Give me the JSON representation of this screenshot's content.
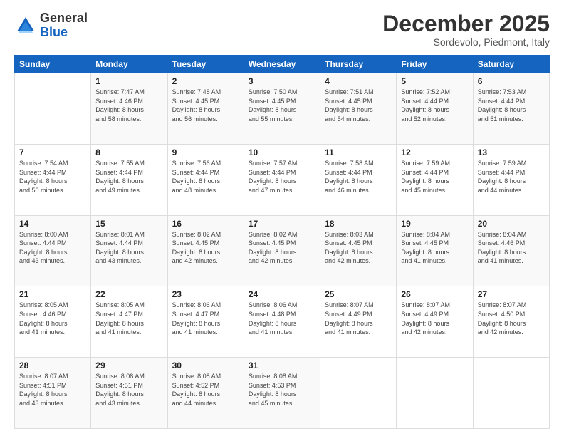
{
  "logo": {
    "general": "General",
    "blue": "Blue"
  },
  "title": "December 2025",
  "subtitle": "Sordevolo, Piedmont, Italy",
  "days_of_week": [
    "Sunday",
    "Monday",
    "Tuesday",
    "Wednesday",
    "Thursday",
    "Friday",
    "Saturday"
  ],
  "weeks": [
    [
      {
        "num": "",
        "detail": ""
      },
      {
        "num": "1",
        "detail": "Sunrise: 7:47 AM\nSunset: 4:46 PM\nDaylight: 8 hours\nand 58 minutes."
      },
      {
        "num": "2",
        "detail": "Sunrise: 7:48 AM\nSunset: 4:45 PM\nDaylight: 8 hours\nand 56 minutes."
      },
      {
        "num": "3",
        "detail": "Sunrise: 7:50 AM\nSunset: 4:45 PM\nDaylight: 8 hours\nand 55 minutes."
      },
      {
        "num": "4",
        "detail": "Sunrise: 7:51 AM\nSunset: 4:45 PM\nDaylight: 8 hours\nand 54 minutes."
      },
      {
        "num": "5",
        "detail": "Sunrise: 7:52 AM\nSunset: 4:44 PM\nDaylight: 8 hours\nand 52 minutes."
      },
      {
        "num": "6",
        "detail": "Sunrise: 7:53 AM\nSunset: 4:44 PM\nDaylight: 8 hours\nand 51 minutes."
      }
    ],
    [
      {
        "num": "7",
        "detail": "Sunrise: 7:54 AM\nSunset: 4:44 PM\nDaylight: 8 hours\nand 50 minutes."
      },
      {
        "num": "8",
        "detail": "Sunrise: 7:55 AM\nSunset: 4:44 PM\nDaylight: 8 hours\nand 49 minutes."
      },
      {
        "num": "9",
        "detail": "Sunrise: 7:56 AM\nSunset: 4:44 PM\nDaylight: 8 hours\nand 48 minutes."
      },
      {
        "num": "10",
        "detail": "Sunrise: 7:57 AM\nSunset: 4:44 PM\nDaylight: 8 hours\nand 47 minutes."
      },
      {
        "num": "11",
        "detail": "Sunrise: 7:58 AM\nSunset: 4:44 PM\nDaylight: 8 hours\nand 46 minutes."
      },
      {
        "num": "12",
        "detail": "Sunrise: 7:59 AM\nSunset: 4:44 PM\nDaylight: 8 hours\nand 45 minutes."
      },
      {
        "num": "13",
        "detail": "Sunrise: 7:59 AM\nSunset: 4:44 PM\nDaylight: 8 hours\nand 44 minutes."
      }
    ],
    [
      {
        "num": "14",
        "detail": "Sunrise: 8:00 AM\nSunset: 4:44 PM\nDaylight: 8 hours\nand 43 minutes."
      },
      {
        "num": "15",
        "detail": "Sunrise: 8:01 AM\nSunset: 4:44 PM\nDaylight: 8 hours\nand 43 minutes."
      },
      {
        "num": "16",
        "detail": "Sunrise: 8:02 AM\nSunset: 4:45 PM\nDaylight: 8 hours\nand 42 minutes."
      },
      {
        "num": "17",
        "detail": "Sunrise: 8:02 AM\nSunset: 4:45 PM\nDaylight: 8 hours\nand 42 minutes."
      },
      {
        "num": "18",
        "detail": "Sunrise: 8:03 AM\nSunset: 4:45 PM\nDaylight: 8 hours\nand 42 minutes."
      },
      {
        "num": "19",
        "detail": "Sunrise: 8:04 AM\nSunset: 4:45 PM\nDaylight: 8 hours\nand 41 minutes."
      },
      {
        "num": "20",
        "detail": "Sunrise: 8:04 AM\nSunset: 4:46 PM\nDaylight: 8 hours\nand 41 minutes."
      }
    ],
    [
      {
        "num": "21",
        "detail": "Sunrise: 8:05 AM\nSunset: 4:46 PM\nDaylight: 8 hours\nand 41 minutes."
      },
      {
        "num": "22",
        "detail": "Sunrise: 8:05 AM\nSunset: 4:47 PM\nDaylight: 8 hours\nand 41 minutes."
      },
      {
        "num": "23",
        "detail": "Sunrise: 8:06 AM\nSunset: 4:47 PM\nDaylight: 8 hours\nand 41 minutes."
      },
      {
        "num": "24",
        "detail": "Sunrise: 8:06 AM\nSunset: 4:48 PM\nDaylight: 8 hours\nand 41 minutes."
      },
      {
        "num": "25",
        "detail": "Sunrise: 8:07 AM\nSunset: 4:49 PM\nDaylight: 8 hours\nand 41 minutes."
      },
      {
        "num": "26",
        "detail": "Sunrise: 8:07 AM\nSunset: 4:49 PM\nDaylight: 8 hours\nand 42 minutes."
      },
      {
        "num": "27",
        "detail": "Sunrise: 8:07 AM\nSunset: 4:50 PM\nDaylight: 8 hours\nand 42 minutes."
      }
    ],
    [
      {
        "num": "28",
        "detail": "Sunrise: 8:07 AM\nSunset: 4:51 PM\nDaylight: 8 hours\nand 43 minutes."
      },
      {
        "num": "29",
        "detail": "Sunrise: 8:08 AM\nSunset: 4:51 PM\nDaylight: 8 hours\nand 43 minutes."
      },
      {
        "num": "30",
        "detail": "Sunrise: 8:08 AM\nSunset: 4:52 PM\nDaylight: 8 hours\nand 44 minutes."
      },
      {
        "num": "31",
        "detail": "Sunrise: 8:08 AM\nSunset: 4:53 PM\nDaylight: 8 hours\nand 45 minutes."
      },
      {
        "num": "",
        "detail": ""
      },
      {
        "num": "",
        "detail": ""
      },
      {
        "num": "",
        "detail": ""
      }
    ]
  ]
}
